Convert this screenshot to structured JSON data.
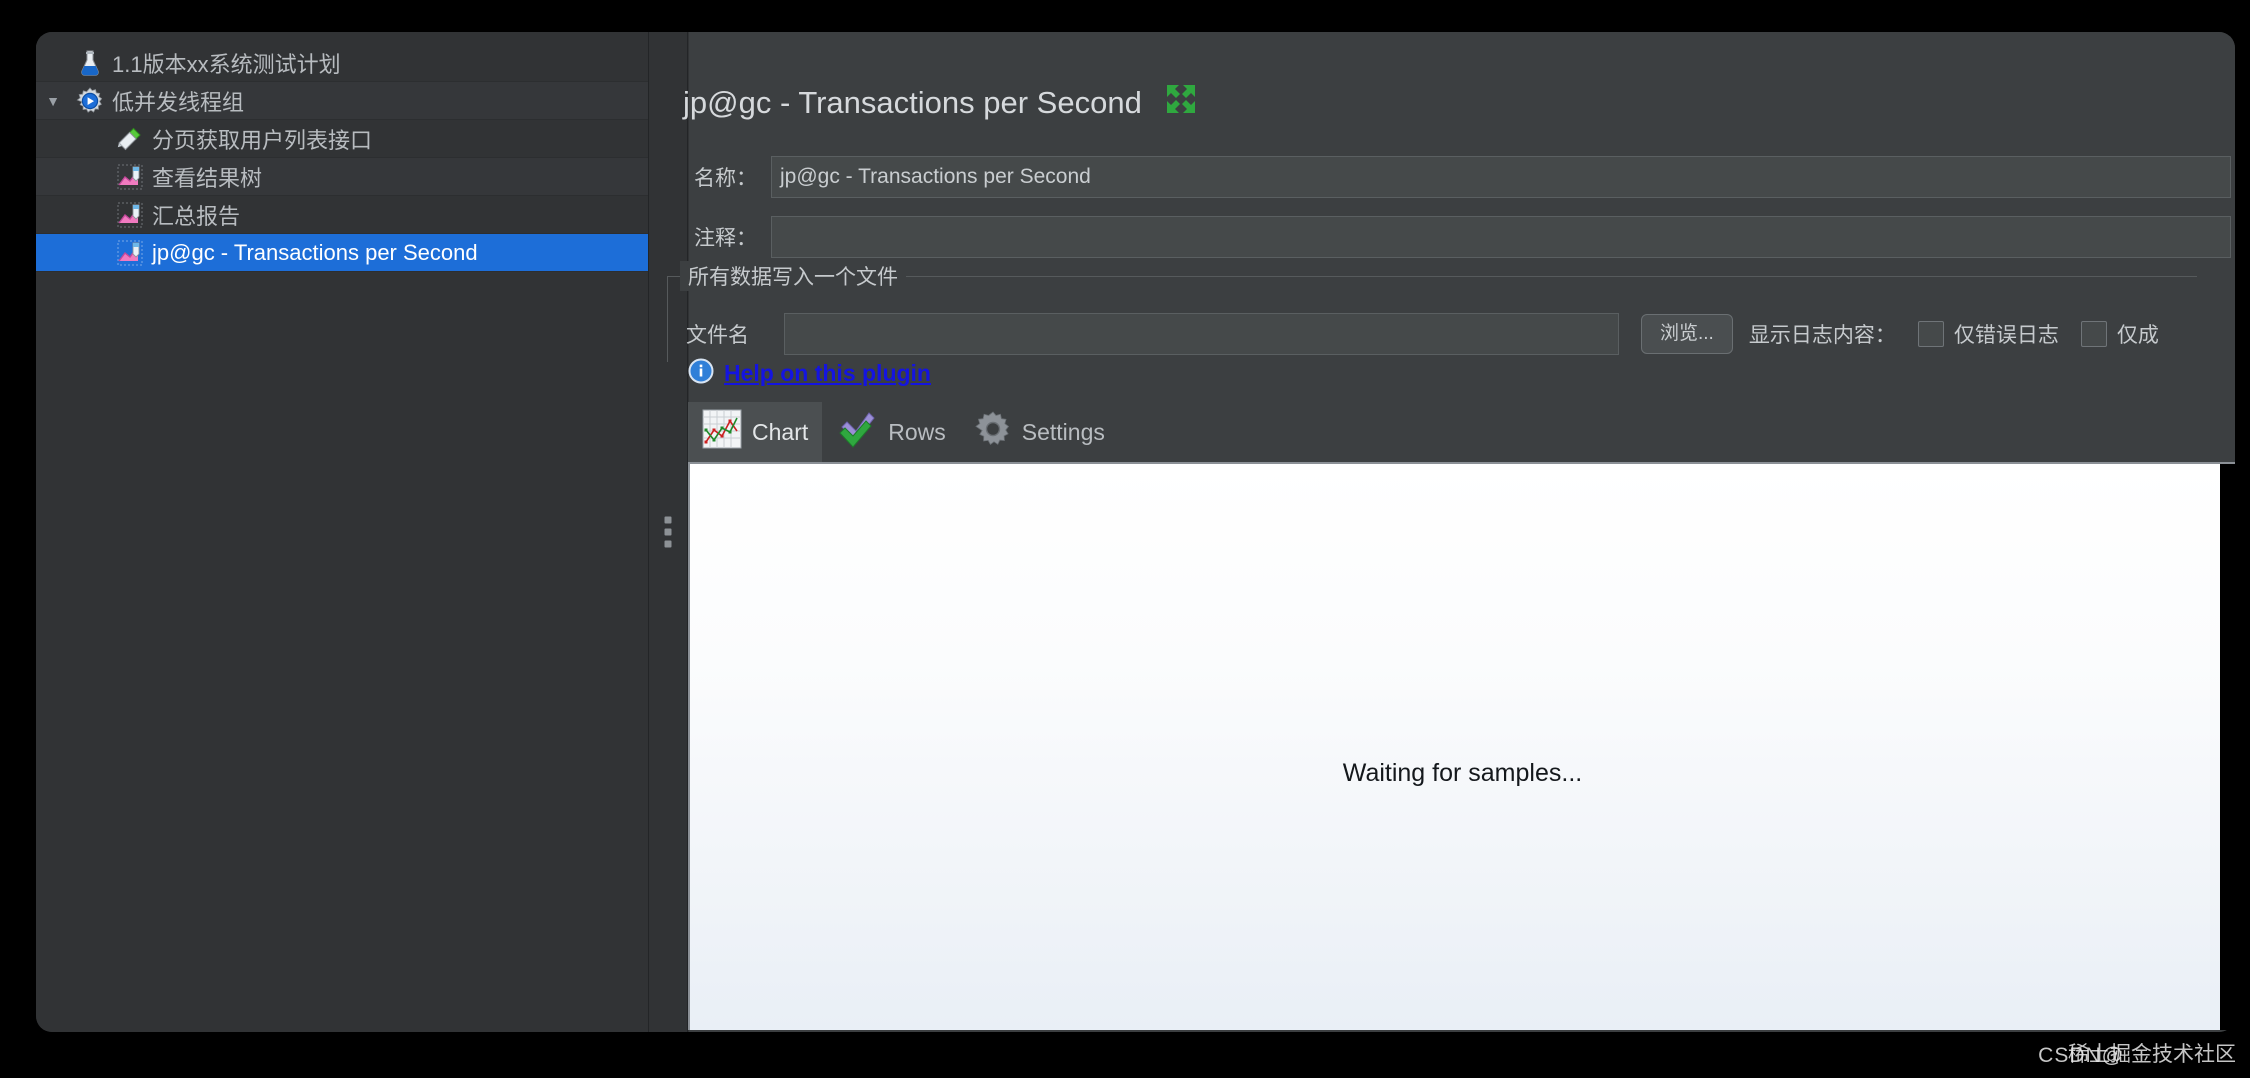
{
  "window": {
    "accent_selected": "#1d6ed8",
    "panel_bg": "#3c3f41",
    "tree_bg": "#313335"
  },
  "tree": {
    "items": [
      {
        "label": "1.1版本xx系统测试计划",
        "icon": "test-plan-flask-icon",
        "indent": 0,
        "twisty": "",
        "selected": false
      },
      {
        "label": "低并发线程组",
        "icon": "thread-group-gear-icon",
        "indent": 1,
        "twisty": "▼",
        "selected": false
      },
      {
        "label": "分页获取用户列表接口",
        "icon": "http-sampler-pipette-icon",
        "indent": 2,
        "twisty": "",
        "selected": false
      },
      {
        "label": "查看结果树",
        "icon": "listener-chart-icon",
        "indent": 2,
        "twisty": "",
        "selected": false
      },
      {
        "label": "汇总报告",
        "icon": "listener-chart-icon",
        "indent": 2,
        "twisty": "",
        "selected": false
      },
      {
        "label": "jp@gc - Transactions per Second",
        "icon": "listener-chart-icon",
        "indent": 2,
        "twisty": "",
        "selected": true
      }
    ]
  },
  "editor": {
    "title": "jp@gc - Transactions per Second",
    "expand_icon": "expand-arrows-icon",
    "name_label": "名称：",
    "name_value": "jp@gc - Transactions per Second",
    "comment_label": "注释：",
    "comment_value": "",
    "comment_placeholder": "",
    "group_title": "所有数据写入一个文件",
    "filename_label": "文件名",
    "filename_value": "",
    "browse_label": "浏览...",
    "log_content_label": "显示日志内容：",
    "checkboxes": [
      {
        "label": "仅错误日志",
        "checked": false
      },
      {
        "label": "仅成",
        "checked": false
      }
    ],
    "help_link": "Help on this plugin",
    "help_icon": "info-icon",
    "tabs": [
      {
        "label": "Chart",
        "icon": "chart-line-icon",
        "active": true
      },
      {
        "label": "Rows",
        "icon": "double-check-icon",
        "active": false
      },
      {
        "label": "Settings",
        "icon": "gear-icon",
        "active": false
      }
    ]
  },
  "chart": {
    "status_text": "Waiting for samples...",
    "bg_top": "#ffffff",
    "bg_bottom": "#e9eff6"
  },
  "watermark": {
    "left_text": "CSDN@",
    "right_text": "稀土掘金技术社区"
  }
}
